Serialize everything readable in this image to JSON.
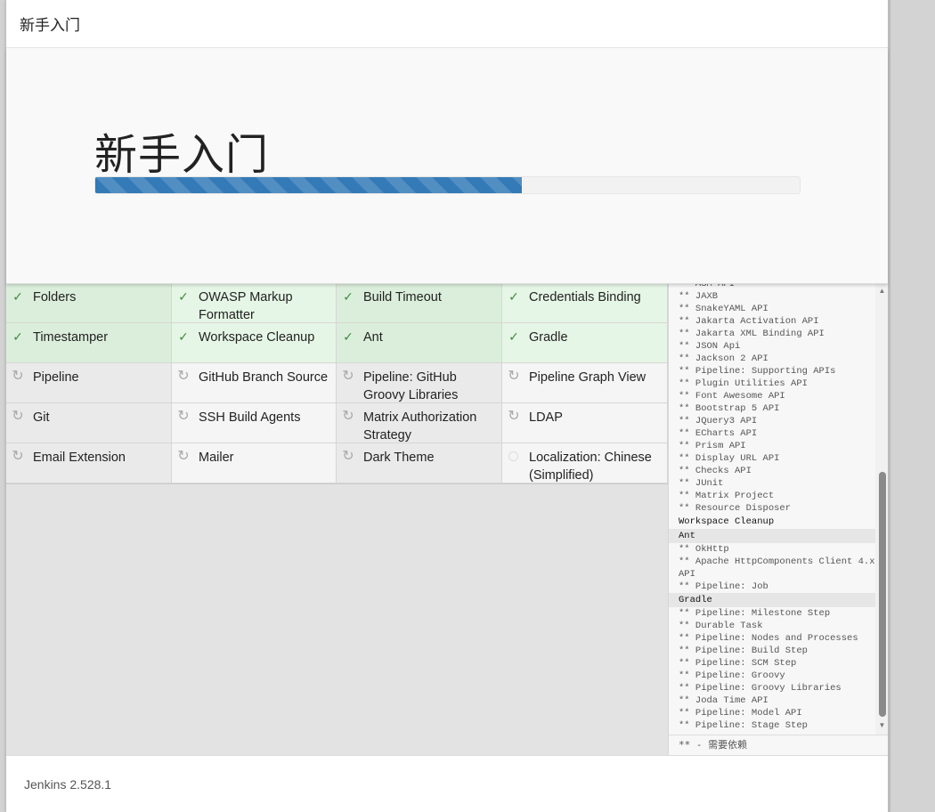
{
  "header": {
    "title": "新手入门"
  },
  "hero": {
    "title": "新手入门",
    "progress_percent": 60.6
  },
  "plugins": [
    {
      "name": "Folders",
      "status": "success"
    },
    {
      "name": "OWASP Markup Formatter",
      "status": "success"
    },
    {
      "name": "Build Timeout",
      "status": "success"
    },
    {
      "name": "Credentials Binding",
      "status": "success"
    },
    {
      "name": "Timestamper",
      "status": "success"
    },
    {
      "name": "Workspace Cleanup",
      "status": "success"
    },
    {
      "name": "Ant",
      "status": "success"
    },
    {
      "name": "Gradle",
      "status": "success"
    },
    {
      "name": "Pipeline",
      "status": "pending"
    },
    {
      "name": "GitHub Branch Source",
      "status": "pending"
    },
    {
      "name": "Pipeline: GitHub Groovy Libraries",
      "status": "pending"
    },
    {
      "name": "Pipeline Graph View",
      "status": "pending"
    },
    {
      "name": "Git",
      "status": "pending"
    },
    {
      "name": "SSH Build Agents",
      "status": "pending"
    },
    {
      "name": "Matrix Authorization Strategy",
      "status": "pending"
    },
    {
      "name": "LDAP",
      "status": "installing"
    },
    {
      "name": "Email Extension",
      "status": "pending"
    },
    {
      "name": "Mailer",
      "status": "installing"
    },
    {
      "name": "Dark Theme",
      "status": "pending"
    },
    {
      "name": "Localization: Chinese (Simplified)",
      "status": "not-started"
    }
  ],
  "status_icons": {
    "success": "✓",
    "pending": "↻",
    "installing": "↻",
    "not-started": ""
  },
  "log": {
    "lines": [
      {
        "text": "** ASM API",
        "type": "dep"
      },
      {
        "text": "** JAXB",
        "type": "dep"
      },
      {
        "text": "** SnakeYAML API",
        "type": "dep"
      },
      {
        "text": "** Jakarta Activation API",
        "type": "dep"
      },
      {
        "text": "** Jakarta XML Binding API",
        "type": "dep"
      },
      {
        "text": "** JSON Api",
        "type": "dep"
      },
      {
        "text": "** Jackson 2 API",
        "type": "dep"
      },
      {
        "text": "** Pipeline: Supporting APIs",
        "type": "dep"
      },
      {
        "text": "** Plugin Utilities API",
        "type": "dep"
      },
      {
        "text": "** Font Awesome API",
        "type": "dep"
      },
      {
        "text": "** Bootstrap 5 API",
        "type": "dep"
      },
      {
        "text": "** JQuery3 API",
        "type": "dep"
      },
      {
        "text": "** ECharts API",
        "type": "dep"
      },
      {
        "text": "** Prism API",
        "type": "dep"
      },
      {
        "text": "** Display URL API",
        "type": "dep"
      },
      {
        "text": "** Checks API",
        "type": "dep"
      },
      {
        "text": "** JUnit",
        "type": "dep"
      },
      {
        "text": "** Matrix Project",
        "type": "dep"
      },
      {
        "text": "** Resource Disposer",
        "type": "dep"
      },
      {
        "text": "Workspace Cleanup",
        "type": "head"
      },
      {
        "text": "Ant",
        "type": "head-hl"
      },
      {
        "text": "** OkHttp",
        "type": "dep"
      },
      {
        "text": "** Apache HttpComponents Client 4.x API",
        "type": "dep"
      },
      {
        "text": "** Pipeline: Job",
        "type": "dep"
      },
      {
        "text": "Gradle",
        "type": "head-hl"
      },
      {
        "text": "** Pipeline: Milestone Step",
        "type": "dep"
      },
      {
        "text": "** Durable Task",
        "type": "dep"
      },
      {
        "text": "** Pipeline: Nodes and Processes",
        "type": "dep"
      },
      {
        "text": "** Pipeline: Build Step",
        "type": "dep"
      },
      {
        "text": "** Pipeline: SCM Step",
        "type": "dep"
      },
      {
        "text": "** Pipeline: Groovy",
        "type": "dep"
      },
      {
        "text": "** Pipeline: Groovy Libraries",
        "type": "dep"
      },
      {
        "text": "** Joda Time API",
        "type": "dep"
      },
      {
        "text": "** Pipeline: Model API",
        "type": "dep"
      },
      {
        "text": "** Pipeline: Stage Step",
        "type": "dep"
      }
    ],
    "footer": "** - 需要依赖"
  },
  "scrollbar": {
    "up": "▲",
    "down": "▼"
  },
  "footer": {
    "version": "Jenkins 2.528.1"
  }
}
